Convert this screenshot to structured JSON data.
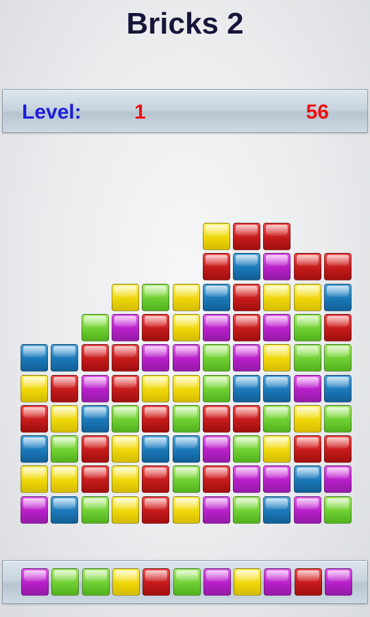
{
  "title": "Bricks 2",
  "level_bar": {
    "label": "Level:",
    "level": "1",
    "bricks_left": "56"
  },
  "colors": {
    "R": "#d42222",
    "B": "#1e7fc0",
    "G": "#78d23a",
    "Y": "#f0d810",
    "P": "#c02ad0"
  },
  "board": {
    "columns": 11,
    "rows": [
      "......YRR..",
      "......RBPRR",
      "...YGYBRYYB",
      "..GPRYPRPGR",
      "BBRRPPGPYGG",
      "YRPRYYGBBPB",
      "RYBGRGRRGYG",
      "BGRYBBPGYRR",
      "YYRYRGRPPBP",
      "PBGYRYPGBPG"
    ]
  },
  "tray": {
    "bricks": "PGGYRGPYPRP"
  }
}
